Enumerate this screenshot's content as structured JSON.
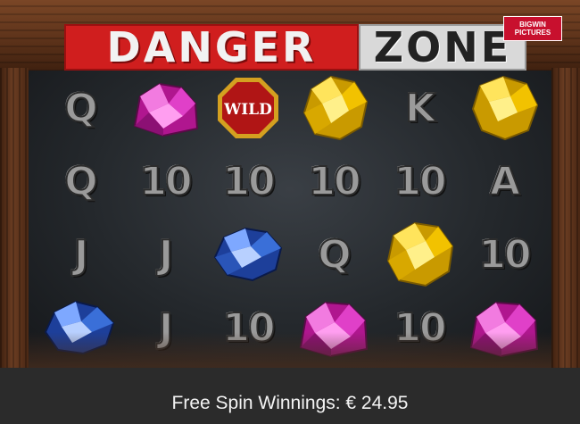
{
  "game": {
    "title_part1": "DANGER",
    "title_part2": "ZONE",
    "logo_line1": "BIGWIN",
    "logo_line2": "PICTURES"
  },
  "reels": {
    "rows": [
      [
        "Q",
        "pink-gem",
        "WILD",
        "gold-nugget",
        "K",
        "gold-nugget"
      ],
      [
        "Q",
        "10",
        "10",
        "10",
        "10",
        "A"
      ],
      [
        "J",
        "J",
        "blue-gem",
        "Q",
        "gold-nugget",
        "10"
      ],
      [
        "blue-gem",
        "J",
        "10",
        "pink-gem",
        "10",
        "pink-gem"
      ]
    ],
    "wild_label": "WILD"
  },
  "footer": {
    "winnings_text": "Free Spin Winnings: € 24.95"
  },
  "colors": {
    "title_red": "#d01e1e",
    "title_grey": "#d9d9d9",
    "gold": "#f2c200",
    "pink": "#e040c8",
    "blue": "#3a6fd8",
    "wild_red": "#b01515"
  }
}
